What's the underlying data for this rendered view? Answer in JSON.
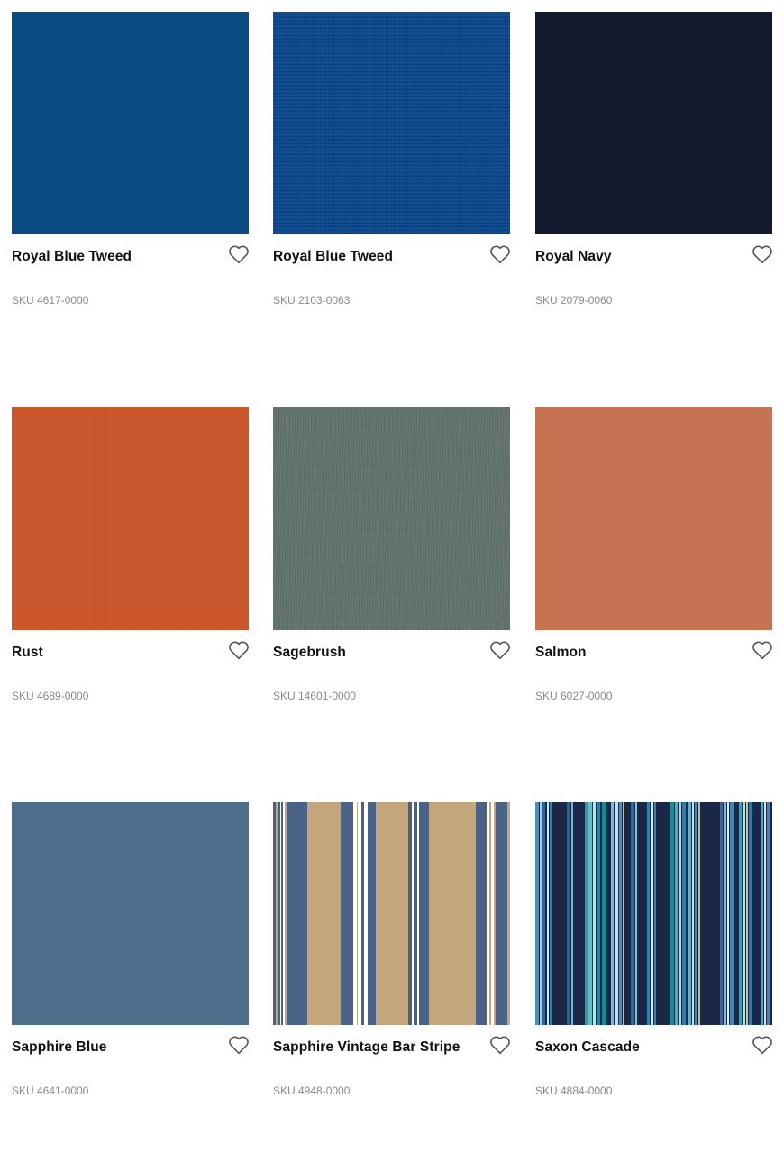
{
  "products": [
    {
      "name": "Royal Blue Tweed",
      "sku": "SKU 4617-0000",
      "swatch": "solid-blue",
      "color": "#0b4983"
    },
    {
      "name": "Royal Blue Tweed",
      "sku": "SKU 2103-0063",
      "swatch": "tweed-blue",
      "color": "#0d4a8f"
    },
    {
      "name": "Royal Navy",
      "sku": "SKU 2079-0060",
      "swatch": "navy",
      "color": "#131a2e"
    },
    {
      "name": "Rust",
      "sku": "SKU 4689-0000",
      "swatch": "rust",
      "color": "#cb5528"
    },
    {
      "name": "Sagebrush",
      "sku": "SKU 14601-0000",
      "swatch": "sage",
      "color": "#627571"
    },
    {
      "name": "Salmon",
      "sku": "SKU 6027-0000",
      "swatch": "salmon",
      "color": "#c67354"
    },
    {
      "name": "Sapphire Blue",
      "sku": "SKU 4641-0000",
      "swatch": "sapphire",
      "color": "#4d6f8b"
    },
    {
      "name": "Sapphire Vintage Bar Stripe",
      "sku": "SKU 4948-0000",
      "swatch": "vintage-bar-stripe",
      "color": "#c4a67d"
    },
    {
      "name": "Saxon Cascade",
      "sku": "SKU 4884-0000",
      "swatch": "cascade-stripe",
      "color": "#1a2a48"
    }
  ],
  "favorite_icon": "heart-outline-icon"
}
